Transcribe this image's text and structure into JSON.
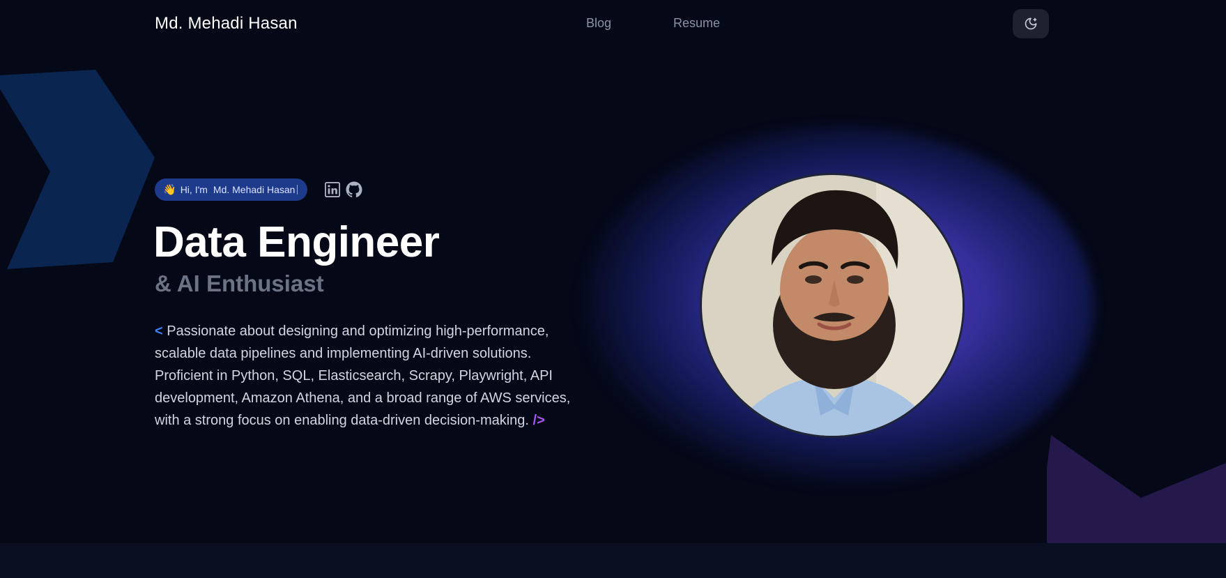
{
  "header": {
    "brand": "Md. Mehadi Hasan",
    "nav": [
      {
        "label": "Blog"
      },
      {
        "label": "Resume"
      }
    ],
    "theme_toggle_icon": "moon-icon"
  },
  "hero": {
    "greeting": {
      "emoji": "👋",
      "prefix": "Hi, I'm",
      "name": "Md. Mehadi Hasan"
    },
    "social_icons": [
      "linkedin-icon",
      "github-icon"
    ],
    "title": "Data Engineer",
    "subtitle": "& AI Enthusiast",
    "bio": {
      "open_tag": "<",
      "text": "Passionate about designing and optimizing high-performance, scalable data pipelines and implementing AI-driven solutions. Proficient in Python, SQL, Elasticsearch, Scrapy, Playwright, API development, Amazon Athena, and a broad range of AWS services, with a strong focus on enabling data-driven decision-making.",
      "close_tag": "/>"
    }
  },
  "colors": {
    "background": "#040817",
    "accent_blue": "#3b82f6",
    "accent_purple": "#a855f7",
    "pill_bg": "#1e3a8a"
  }
}
